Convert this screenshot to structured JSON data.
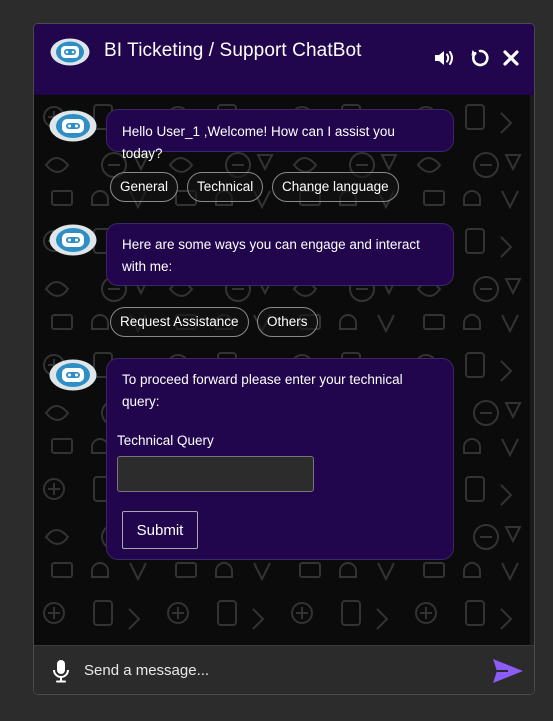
{
  "header": {
    "title": "BI Ticketing / Support ChatBot",
    "icons": [
      "bot-logo-icon",
      "speaker-icon",
      "refresh-icon",
      "close-icon"
    ]
  },
  "messages": [
    {
      "text": "Hello User_1 ,Welcome! How can I assist you today?",
      "options": [
        "General",
        "Technical",
        "Change language"
      ]
    },
    {
      "text": "Here are some ways you can engage and interact with me:",
      "options": [
        "Request Assistance",
        "Others"
      ]
    },
    {
      "text": "To proceed forward please enter your technical query:",
      "form": {
        "field_label": "Technical Query",
        "field_value": "",
        "submit_label": "Submit"
      }
    }
  ],
  "composer": {
    "placeholder": "Send a message...",
    "icons": [
      "microphone-icon",
      "send-icon"
    ]
  },
  "colors": {
    "brand": "#22064d",
    "send_accent": "#8b5cf6",
    "page_background": "#2c2c2c",
    "avatar_blue": "#2f8fc4"
  }
}
